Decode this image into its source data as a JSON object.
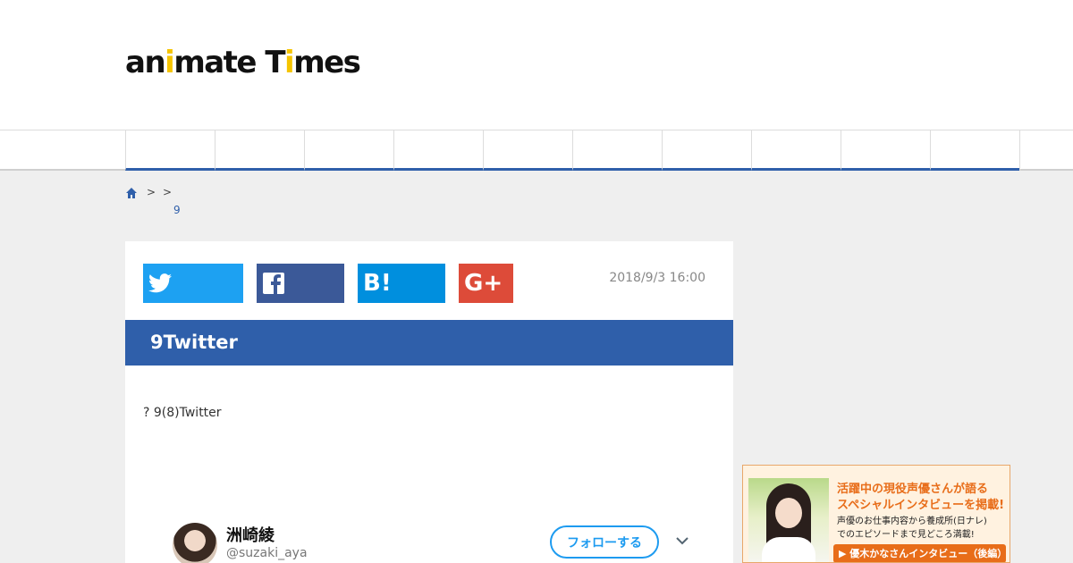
{
  "logo": {
    "prefix": "an",
    "highlight": "i",
    "suffix": "mate T",
    "highlight2": "i",
    "suffix2": "mes"
  },
  "breadcrumb": {
    "sep1": ">",
    "sep2": ">",
    "current": "9"
  },
  "share": {
    "twitter_icon": "twitter-icon",
    "facebook_icon": "facebook-icon",
    "hatena_label": "B!",
    "gplus_label": "G+"
  },
  "article": {
    "date": "2018/9/3 16:00",
    "title": "9Twitter",
    "body": "? 9(8)Twitter"
  },
  "tweet": {
    "name": "洲崎綾",
    "handle": "@suzaki_aya",
    "follow_label": "フォローする"
  },
  "ad": {
    "headline1": "活躍中の現役声優さんが語る",
    "headline2": "スペシャルインタビューを掲載!",
    "sub1": "声優のお仕事内容から養成所(日ナレ)",
    "sub2": "でのエピソードまで見どころ満載!",
    "button": "▶ 優木かなさんインタビュー（後編）"
  },
  "colors": {
    "accent": "#2f5faa",
    "twitter": "#1da1f2",
    "facebook": "#3b5998",
    "hatena": "#008fde",
    "gplus": "#dd4b39",
    "ad_orange": "#e86d19"
  }
}
